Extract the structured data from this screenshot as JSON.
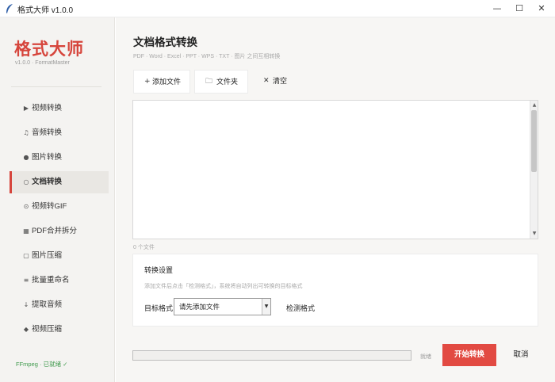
{
  "window": {
    "title": "格式大师 v1.0.0",
    "controls": {
      "minimize": "—",
      "maximize": "☐",
      "close": "✕"
    }
  },
  "sidebar": {
    "brand": "格式大师",
    "version": "v1.0.0 · FormatMaster",
    "items": [
      {
        "icon": "play-icon",
        "glyph": "▶",
        "label": "视频转换",
        "active": false
      },
      {
        "icon": "music-note-icon",
        "glyph": "♫",
        "label": "音频转换",
        "active": false
      },
      {
        "icon": "image-dot-icon",
        "glyph": "●",
        "label": "图片转换",
        "active": false
      },
      {
        "icon": "document-circle-icon",
        "glyph": "○",
        "label": "文档转换",
        "active": true
      },
      {
        "icon": "gif-circle-icon",
        "glyph": "⊙",
        "label": "视频转GIF",
        "active": false
      },
      {
        "icon": "pdf-grid-icon",
        "glyph": "▦",
        "label": "PDF合并拆分",
        "active": false
      },
      {
        "icon": "compress-square-icon",
        "glyph": "▢",
        "label": "图片压缩",
        "active": false
      },
      {
        "icon": "rename-icon",
        "glyph": "≡",
        "label": "批量重命名",
        "active": false
      },
      {
        "icon": "extract-arrow-icon",
        "glyph": "↓",
        "label": "提取音频",
        "active": false
      },
      {
        "icon": "compress-diamond-icon",
        "glyph": "◆",
        "label": "视频压缩",
        "active": false
      }
    ],
    "status": "FFmpeg · 已就绪 ✓"
  },
  "main": {
    "title": "文档格式转换",
    "subtitle": "PDF · Word · Excel · PPT · WPS · TXT · 图片 之间互相转换",
    "toolbar": {
      "add_file": {
        "icon": "plus-icon",
        "glyph": "+",
        "label": "添加文件"
      },
      "add_folder": {
        "icon": "folder-icon",
        "glyph": "🗀",
        "label": "文件夹"
      },
      "clear": {
        "icon": "clear-x-icon",
        "glyph": "✕",
        "label": "清空"
      }
    },
    "file_count": "0 个文件",
    "settings": {
      "title": "转换设置",
      "hint": "添加文件后点击「检测格式」，系统将自动列出可转换的目标格式",
      "target_label": "目标格式",
      "target_value": "请先添加文件",
      "detect_label": "检测格式"
    },
    "progress": {
      "value": 0,
      "status": "就绪"
    },
    "start_label": "开始转换",
    "cancel_label": "取消"
  },
  "colors": {
    "accent": "#d6453c",
    "start_button": "#e24a42",
    "status_ok": "#3f9a4d"
  }
}
